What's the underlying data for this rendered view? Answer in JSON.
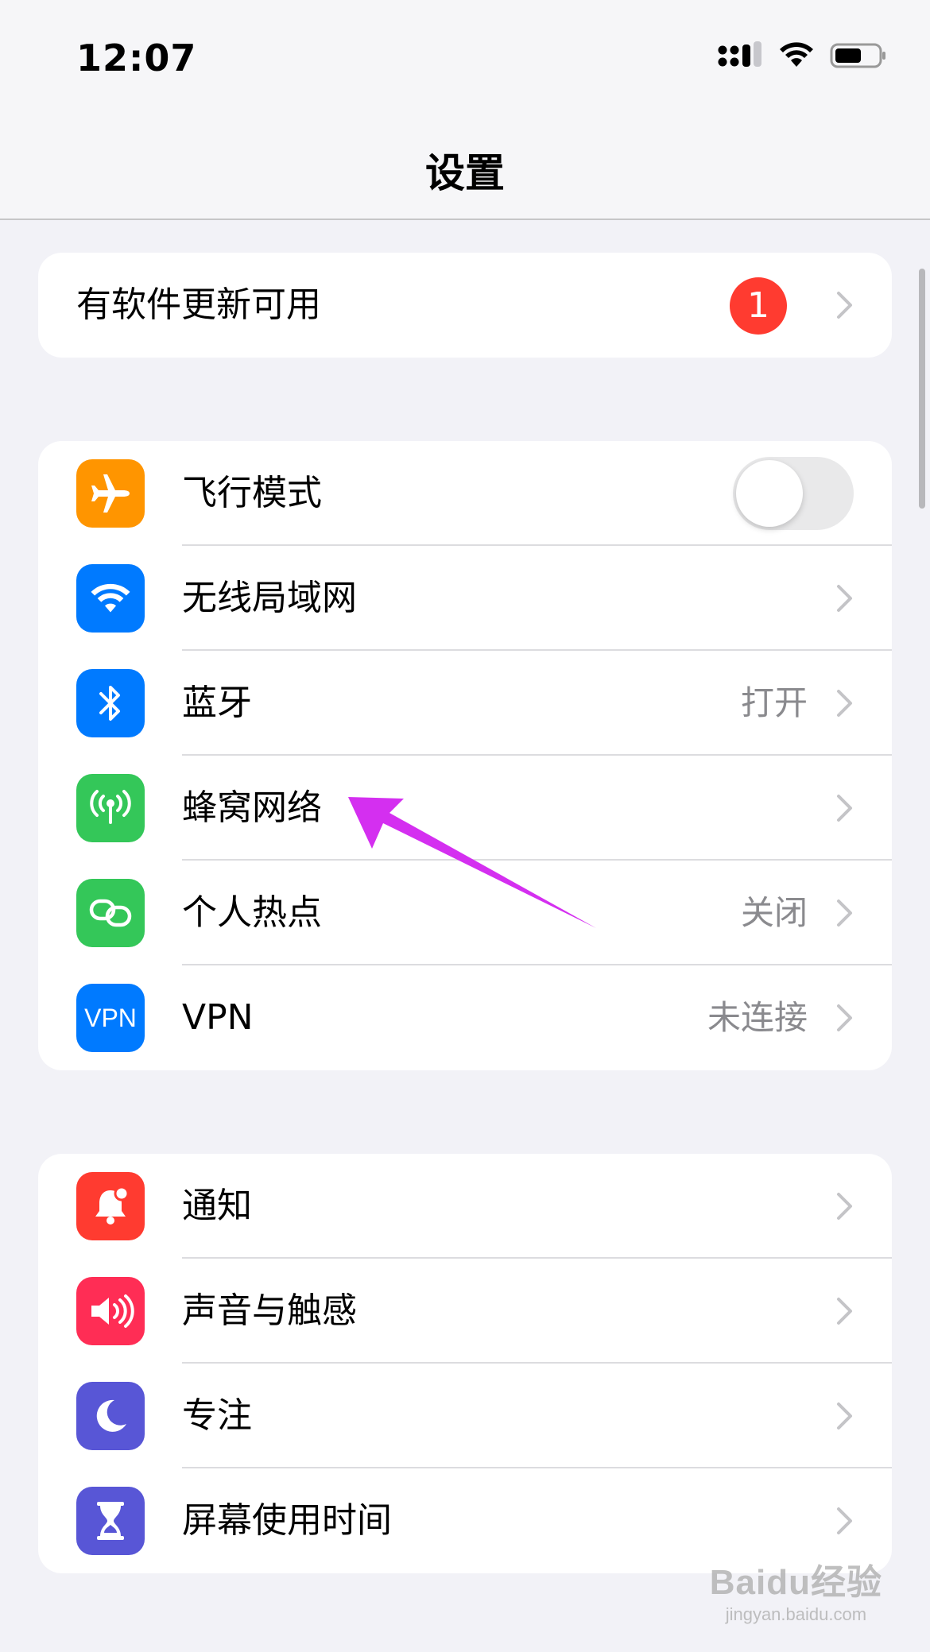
{
  "status_bar": {
    "time": "12:07"
  },
  "nav": {
    "title": "设置"
  },
  "update_banner": {
    "label": "有软件更新可用",
    "badge": "1"
  },
  "connectivity": [
    {
      "label": "飞行模式",
      "value": "",
      "toggle": "off",
      "icon": "airplane-icon",
      "color": "#ff9500"
    },
    {
      "label": "无线局域网",
      "value": "",
      "icon": "wifi-icon",
      "color": "#007aff"
    },
    {
      "label": "蓝牙",
      "value": "打开",
      "icon": "bluetooth-icon",
      "color": "#007aff"
    },
    {
      "label": "蜂窝网络",
      "value": "",
      "icon": "cellular-antenna-icon",
      "color": "#34c759"
    },
    {
      "label": "个人热点",
      "value": "关闭",
      "icon": "hotspot-icon",
      "color": "#34c759"
    },
    {
      "label": "VPN",
      "value": "未连接",
      "icon": "vpn-icon",
      "icon_text": "VPN",
      "color": "#007aff"
    }
  ],
  "notifications_group": [
    {
      "label": "通知",
      "icon": "notification-bell-icon",
      "color": "#ff3b30"
    },
    {
      "label": "声音与触感",
      "icon": "speaker-icon",
      "color": "#ff2d55"
    },
    {
      "label": "专注",
      "icon": "moon-icon",
      "color": "#5856d6"
    },
    {
      "label": "屏幕使用时间",
      "icon": "hourglass-icon",
      "color": "#5856d6"
    }
  ],
  "annotation": {
    "color": "#d42ff0"
  },
  "watermark": {
    "main": "Baidu经验",
    "sub": "jingyan.baidu.com"
  }
}
